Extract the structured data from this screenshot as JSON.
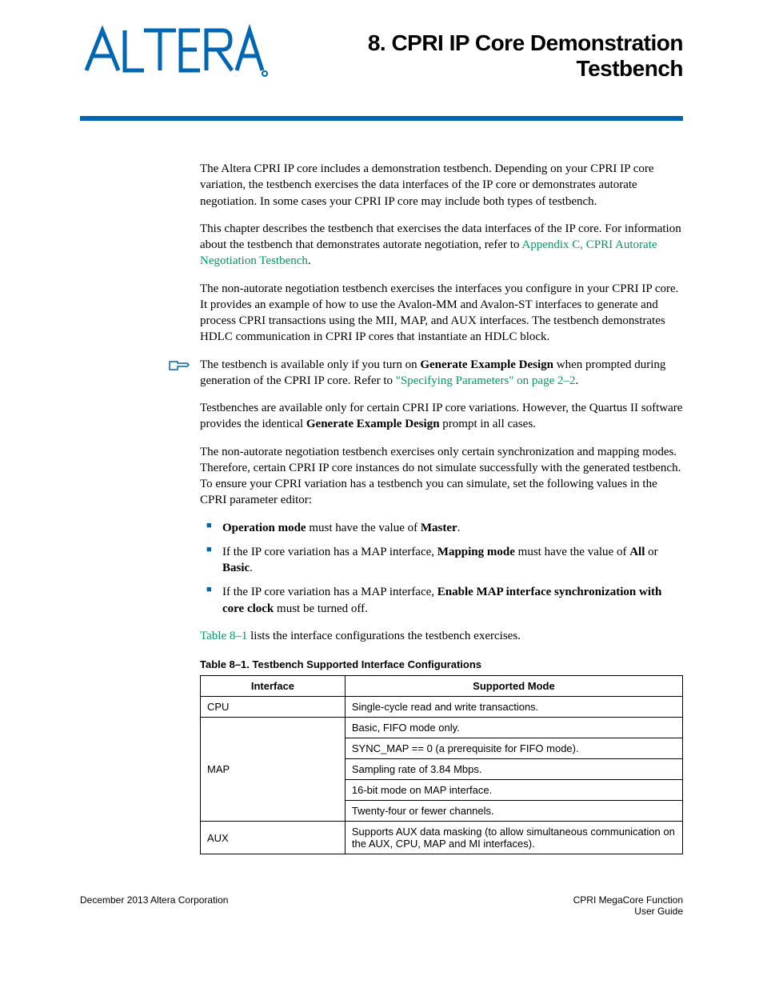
{
  "header": {
    "logo_alt": "ALTERA",
    "chapter_title": "8.  CPRI IP Core Demonstration Testbench"
  },
  "paragraphs": {
    "p1": "The Altera CPRI IP core includes a demonstration testbench. Depending on your CPRI IP core variation, the testbench exercises the data interfaces of the IP core or demonstrates autorate negotiation. In some cases your CPRI IP core may include both types of testbench.",
    "p2a": "This chapter describes the testbench that exercises the data interfaces of the IP core. For information about the testbench that demonstrates autorate negotiation, refer to ",
    "p2link": "Appendix C, CPRI Autorate Negotiation Testbench",
    "p2b": ".",
    "p3": "The non-autorate negotiation testbench exercises the interfaces you configure in your CPRI IP core. It provides an example of how to use the Avalon-MM and Avalon-ST interfaces to generate and process CPRI transactions using the MII, MAP, and AUX interfaces. The testbench demonstrates HDLC communication in CPRI IP cores that instantiate an HDLC block.",
    "p4a": "The testbench is available only if you turn on ",
    "p4b": "Generate Example Design",
    "p4c": " when prompted during generation of the CPRI IP core. Refer to ",
    "p4link": "\"Specifying Parameters\" on page 2–2",
    "p4d": ".",
    "p5a": "Testbenches are available only for certain CPRI IP core variations. However, the Quartus II software provides the identical ",
    "p5b": "Generate Example Design",
    "p5c": " prompt in all cases.",
    "p6": "The non-autorate negotiation testbench exercises only certain synchronization and mapping modes. Therefore, certain CPRI IP core instances do not simulate successfully with the generated testbench. To ensure your CPRI variation has a testbench you can simulate, set the following values in the CPRI parameter editor:",
    "p7a": "Table 8–1",
    "p7b": " lists the interface configurations the testbench exercises."
  },
  "bullets": {
    "b1a": "Operation mode",
    "b1b": " must have the value of ",
    "b1c": "Master",
    "b1d": ".",
    "b2a": "If the IP core variation has a MAP interface, ",
    "b2b": "Mapping mode",
    "b2c": " must have the value of ",
    "b2d": "All",
    "b2e": " or ",
    "b2f": "Basic",
    "b2g": ".",
    "b3a": "If the IP core variation has a MAP interface, ",
    "b3b": "Enable MAP interface synchronization with core clock",
    "b3c": " must be turned off."
  },
  "table": {
    "caption": "Table 8–1.  Testbench Supported Interface Configurations",
    "headers": {
      "col1": "Interface",
      "col2": "Supported Mode"
    },
    "rows": {
      "cpu_iface": "CPU",
      "cpu_mode": "Single-cycle read and write transactions.",
      "map_iface": "MAP",
      "map_mode1": "Basic, FIFO mode only.",
      "map_mode2": "SYNC_MAP == 0 (a prerequisite for FIFO mode).",
      "map_mode3": "Sampling rate of 3.84 Mbps.",
      "map_mode4": "16-bit mode on MAP interface.",
      "map_mode5": "Twenty-four or fewer channels.",
      "aux_iface": "AUX",
      "aux_mode": "Supports AUX data masking (to allow simultaneous communication on the AUX, CPU, MAP and MI interfaces)."
    }
  },
  "footer": {
    "left": "December 2013   Altera Corporation",
    "right1": "CPRI MegaCore Function",
    "right2": "User Guide"
  }
}
